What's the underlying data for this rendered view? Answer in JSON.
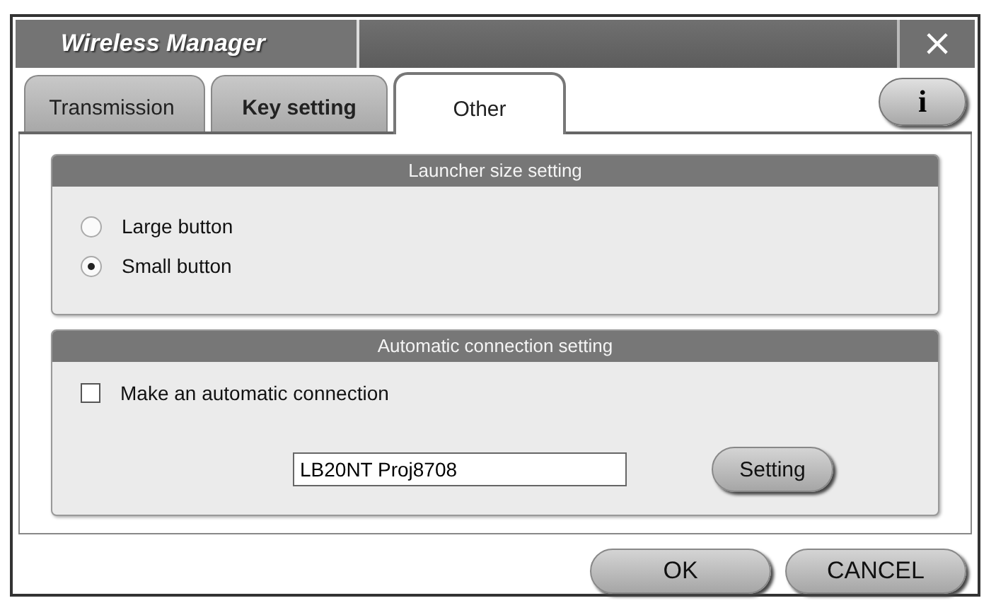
{
  "window": {
    "title": "Wireless Manager",
    "close": "×"
  },
  "tabs": [
    {
      "label": "Transmission",
      "selected": false
    },
    {
      "label": "Key setting",
      "selected": false
    },
    {
      "label": "Other",
      "selected": true
    }
  ],
  "info_button": "i",
  "sections": [
    {
      "title": "Launcher size setting",
      "options": [
        {
          "kind": "radio",
          "label": "Large button",
          "selected": false
        },
        {
          "kind": "radio",
          "label": "Small button",
          "selected": true
        }
      ]
    },
    {
      "title": "Automatic connection setting",
      "options": [
        {
          "kind": "checkbox",
          "label": "Make an automatic connection",
          "checked": false
        },
        {
          "kind": "field",
          "value": "LB20NT Proj8708",
          "button": "Setting"
        }
      ]
    }
  ],
  "buttons": [
    "OK",
    "CANCEL"
  ]
}
